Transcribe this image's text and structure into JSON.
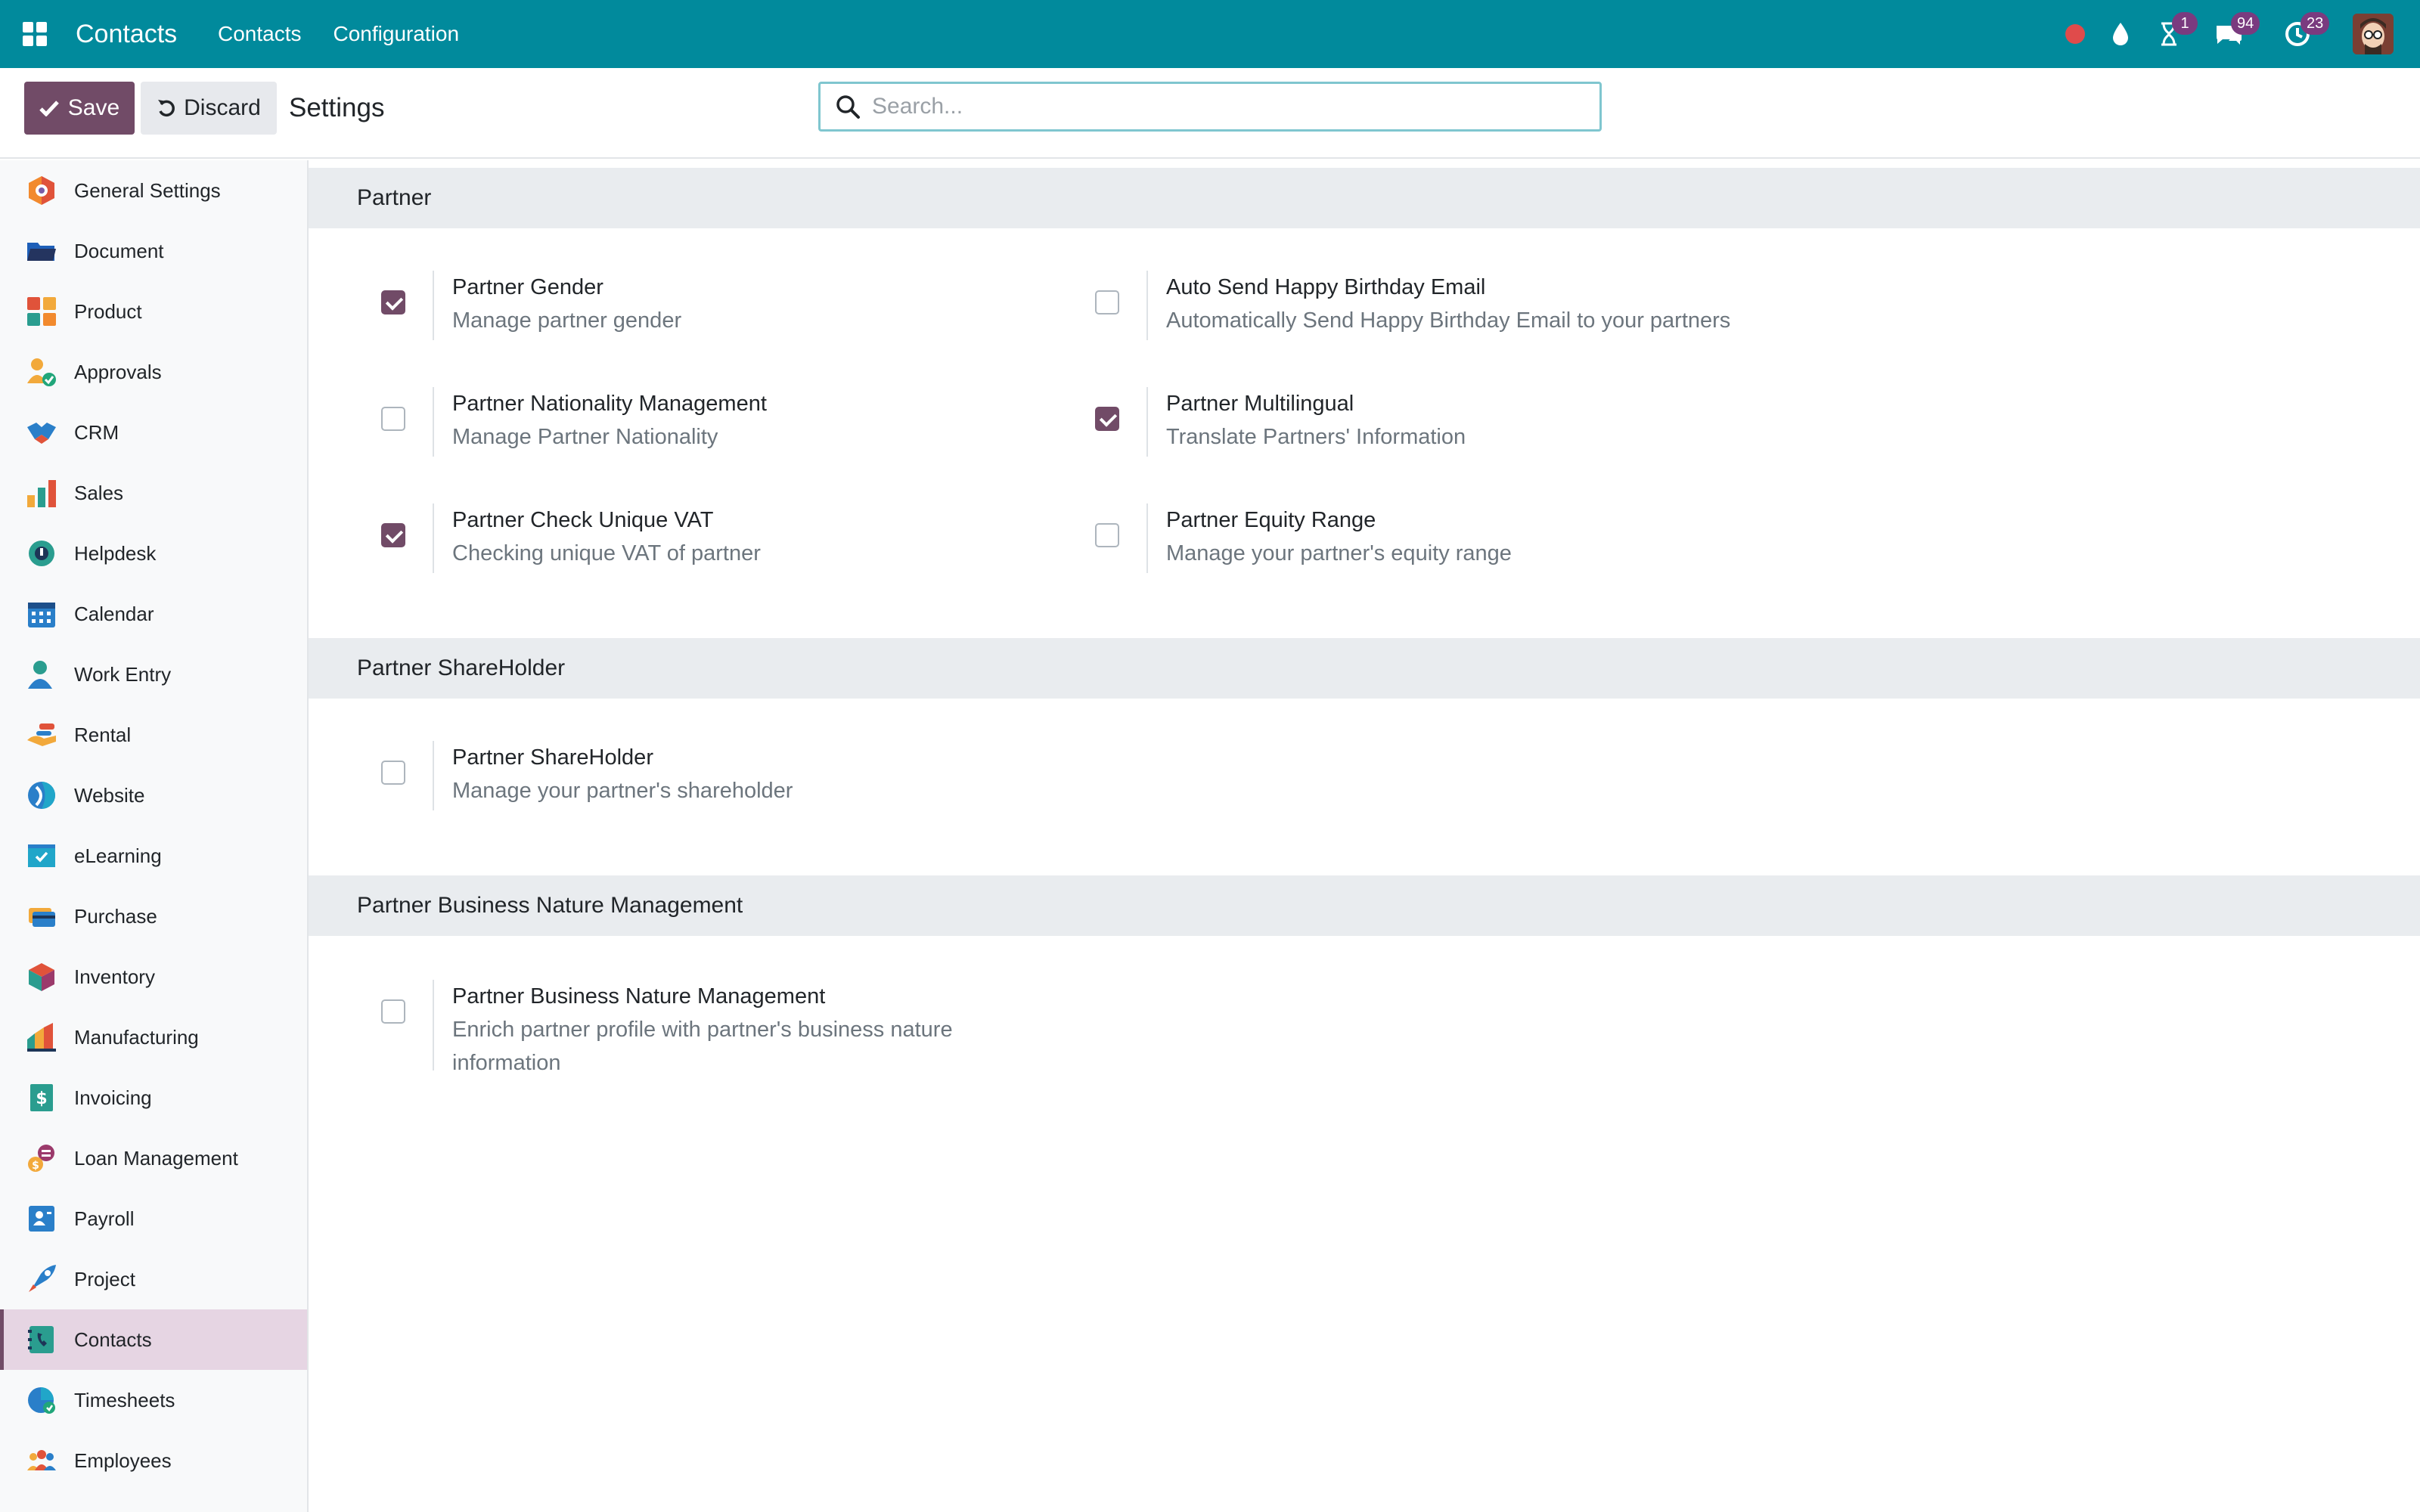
{
  "navbar": {
    "brand": "Contacts",
    "menu": [
      "Contacts",
      "Configuration"
    ],
    "systray": {
      "activity_badge": "1",
      "messages_badge": "94",
      "activities_badge": "23"
    }
  },
  "control_panel": {
    "save_label": "Save",
    "discard_label": "Discard",
    "title": "Settings",
    "search_placeholder": "Search..."
  },
  "sidebar": {
    "items": [
      {
        "label": "General Settings",
        "icon": "general-settings-icon"
      },
      {
        "label": "Document",
        "icon": "document-icon"
      },
      {
        "label": "Product",
        "icon": "product-icon"
      },
      {
        "label": "Approvals",
        "icon": "approvals-icon"
      },
      {
        "label": "CRM",
        "icon": "crm-icon"
      },
      {
        "label": "Sales",
        "icon": "sales-icon"
      },
      {
        "label": "Helpdesk",
        "icon": "helpdesk-icon"
      },
      {
        "label": "Calendar",
        "icon": "calendar-icon"
      },
      {
        "label": "Work Entry",
        "icon": "work-entry-icon"
      },
      {
        "label": "Rental",
        "icon": "rental-icon"
      },
      {
        "label": "Website",
        "icon": "website-icon"
      },
      {
        "label": "eLearning",
        "icon": "elearning-icon"
      },
      {
        "label": "Purchase",
        "icon": "purchase-icon"
      },
      {
        "label": "Inventory",
        "icon": "inventory-icon"
      },
      {
        "label": "Manufacturing",
        "icon": "manufacturing-icon"
      },
      {
        "label": "Invoicing",
        "icon": "invoicing-icon"
      },
      {
        "label": "Loan Management",
        "icon": "loan-management-icon"
      },
      {
        "label": "Payroll",
        "icon": "payroll-icon"
      },
      {
        "label": "Project",
        "icon": "project-icon"
      },
      {
        "label": "Contacts",
        "icon": "contacts-icon",
        "active": true
      },
      {
        "label": "Timesheets",
        "icon": "timesheets-icon"
      },
      {
        "label": "Employees",
        "icon": "employees-icon"
      }
    ]
  },
  "sections": [
    {
      "title": "Partner",
      "settings": [
        {
          "title": "Partner Gender",
          "description": "Manage partner gender",
          "checked": true
        },
        {
          "title": "Auto Send Happy Birthday Email",
          "description": "Automatically Send Happy Birthday Email to your partners",
          "checked": false
        },
        {
          "title": "Partner Nationality Management",
          "description": "Manage Partner Nationality",
          "checked": false
        },
        {
          "title": "Partner Multilingual",
          "description": "Translate Partners' Information",
          "checked": true
        },
        {
          "title": "Partner Check Unique VAT",
          "description": "Checking unique VAT of partner",
          "checked": true
        },
        {
          "title": "Partner Equity Range",
          "description": "Manage your partner's equity range",
          "checked": false
        }
      ]
    },
    {
      "title": "Partner ShareHolder",
      "settings": [
        {
          "title": "Partner ShareHolder",
          "description": "Manage your partner's shareholder",
          "checked": false
        }
      ]
    },
    {
      "title": "Partner Business Nature Management",
      "settings": [
        {
          "title": "Partner Business Nature Management",
          "description": "Enrich partner profile with partner's business nature information",
          "checked": false
        }
      ]
    }
  ],
  "colors": {
    "navbar": "#018a9c",
    "primary": "#714b67",
    "section_header": "#e9ecef",
    "sidebar_active": "#e6d5e3"
  }
}
